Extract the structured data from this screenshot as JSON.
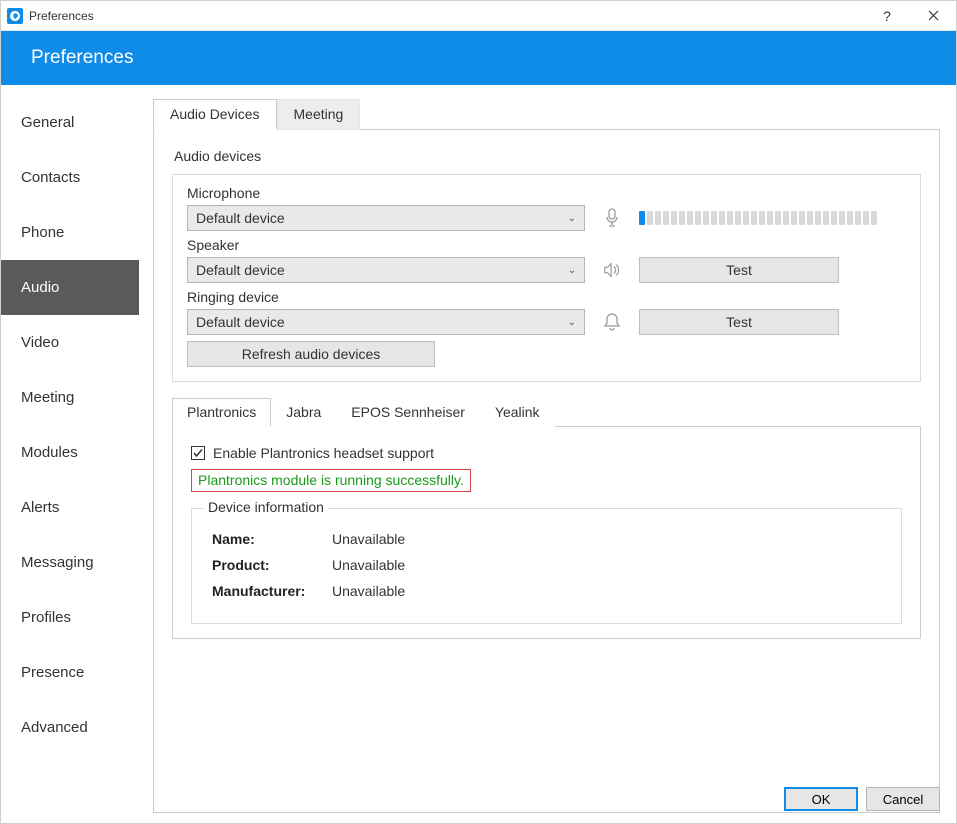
{
  "window": {
    "title": "Preferences",
    "help": "?",
    "close": "✕"
  },
  "header": {
    "title": "Preferences"
  },
  "sidebar": {
    "items": [
      {
        "label": "General",
        "sel": false
      },
      {
        "label": "Contacts",
        "sel": false
      },
      {
        "label": "Phone",
        "sel": false
      },
      {
        "label": "Audio",
        "sel": true
      },
      {
        "label": "Video",
        "sel": false
      },
      {
        "label": "Meeting",
        "sel": false
      },
      {
        "label": "Modules",
        "sel": false
      },
      {
        "label": "Alerts",
        "sel": false
      },
      {
        "label": "Messaging",
        "sel": false
      },
      {
        "label": "Profiles",
        "sel": false
      },
      {
        "label": "Presence",
        "sel": false
      },
      {
        "label": "Advanced",
        "sel": false
      }
    ]
  },
  "tabs": {
    "items": [
      {
        "label": "Audio Devices",
        "sel": true
      },
      {
        "label": "Meeting",
        "sel": false
      }
    ]
  },
  "audio": {
    "section_title": "Audio devices",
    "microphone": {
      "label": "Microphone",
      "value": "Default device",
      "level_active": 1,
      "level_total": 30
    },
    "speaker": {
      "label": "Speaker",
      "value": "Default device",
      "test": "Test"
    },
    "ringing": {
      "label": "Ringing device",
      "value": "Default device",
      "test": "Test"
    },
    "refresh": "Refresh audio devices"
  },
  "headset_tabs": {
    "items": [
      {
        "label": "Plantronics",
        "sel": true
      },
      {
        "label": "Jabra",
        "sel": false
      },
      {
        "label": "EPOS Sennheiser",
        "sel": false
      },
      {
        "label": "Yealink",
        "sel": false
      }
    ]
  },
  "plantronics": {
    "enable_label": "Enable Plantronics headset support",
    "enabled": true,
    "status": "Plantronics module is running successfully.",
    "device_info_title": "Device information",
    "rows": [
      {
        "k": "Name:",
        "v": "Unavailable"
      },
      {
        "k": "Product:",
        "v": "Unavailable"
      },
      {
        "k": "Manufacturer:",
        "v": "Unavailable"
      }
    ]
  },
  "footer": {
    "ok": "OK",
    "cancel": "Cancel"
  }
}
